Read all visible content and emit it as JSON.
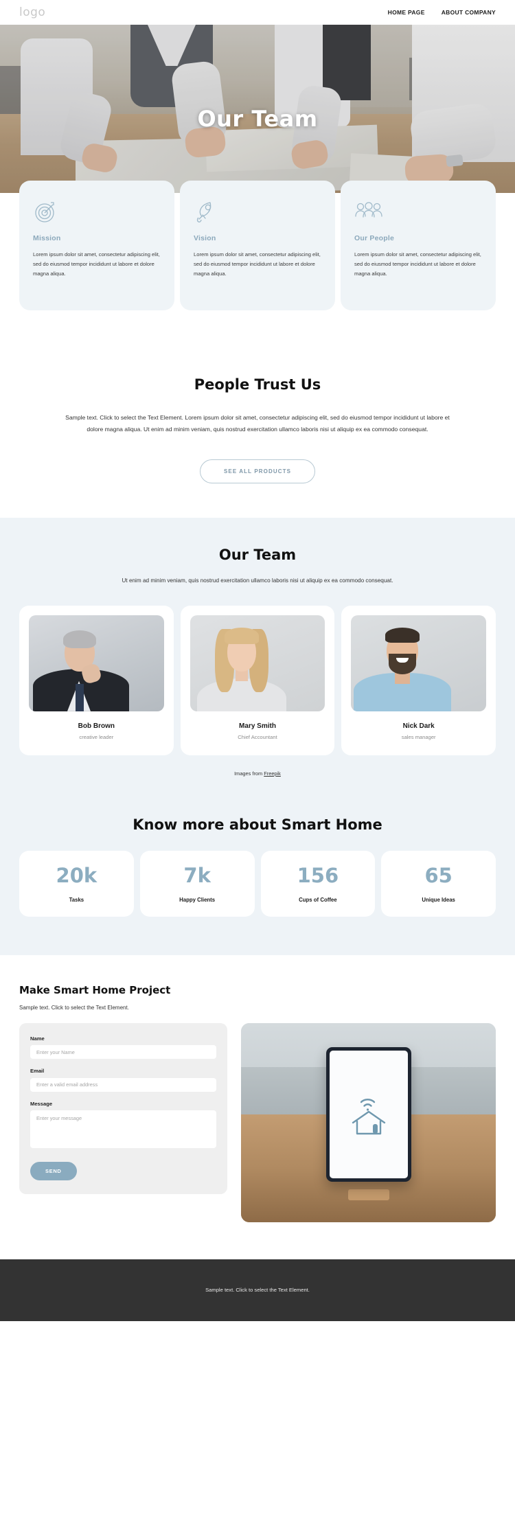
{
  "header": {
    "logo": "logo",
    "nav": [
      {
        "label": "HOME PAGE"
      },
      {
        "label": "ABOUT COMPANY"
      }
    ]
  },
  "hero": {
    "title": "Our Team"
  },
  "features": [
    {
      "icon": "target-icon",
      "title": "Mission",
      "text": "Lorem ipsum dolor sit amet, consectetur adipiscing elit, sed do eiusmod tempor incididunt ut labore et dolore magna aliqua."
    },
    {
      "icon": "rocket-icon",
      "title": "Vision",
      "text": "Lorem ipsum dolor sit amet, consectetur adipiscing elit, sed do eiusmod tempor incididunt ut labore et dolore magna aliqua."
    },
    {
      "icon": "people-group-icon",
      "title": "Our People",
      "text": "Lorem ipsum dolor sit amet, consectetur adipiscing elit, sed do eiusmod tempor incididunt ut labore et dolore magna aliqua."
    }
  ],
  "trust": {
    "heading": "People Trust Us",
    "paragraph": "Sample text. Click to select the Text Element. Lorem ipsum dolor sit amet, consectetur adipiscing elit, sed do eiusmod tempor incididunt ut labore et dolore magna aliqua. Ut enim ad minim veniam, quis nostrud exercitation ullamco laboris nisi ut aliquip ex ea commodo consequat.",
    "button_label": "SEE ALL PRODUCTS"
  },
  "team": {
    "heading": "Our Team",
    "subtitle": "Ut enim ad minim veniam, quis nostrud exercitation ullamco laboris nisi ut aliquip ex ea commodo consequat.",
    "members": [
      {
        "name": "Bob Brown",
        "role": "creative leader"
      },
      {
        "name": "Mary Smith",
        "role": "Chief Accountant"
      },
      {
        "name": "Nick Dark",
        "role": "sales manager"
      }
    ],
    "credit_prefix": "Images from ",
    "credit_link": "Freepik"
  },
  "stats": {
    "heading": "Know more about Smart Home",
    "items": [
      {
        "value": "20k",
        "label": "Tasks"
      },
      {
        "value": "7k",
        "label": "Happy Clients"
      },
      {
        "value": "156",
        "label": "Cups of Coffee"
      },
      {
        "value": "65",
        "label": "Unique Ideas"
      }
    ]
  },
  "contact": {
    "heading": "Make Smart Home Project",
    "lead": "Sample text. Click to select the Text Element.",
    "fields": {
      "name_label": "Name",
      "name_placeholder": "Enter your Name",
      "email_label": "Email",
      "email_placeholder": "Enter a valid email address",
      "message_label": "Message",
      "message_placeholder": "Enter your message"
    },
    "send_label": "SEND"
  },
  "footer": {
    "text": "Sample text. Click to select the Text Element."
  },
  "colors": {
    "accent": "#8aabbf",
    "card_bg": "#eff4f7",
    "section_bg": "#eef3f7",
    "footer_bg": "#333333",
    "stat_number": "#8cadc0",
    "muted_text": "#8d8d8d"
  }
}
